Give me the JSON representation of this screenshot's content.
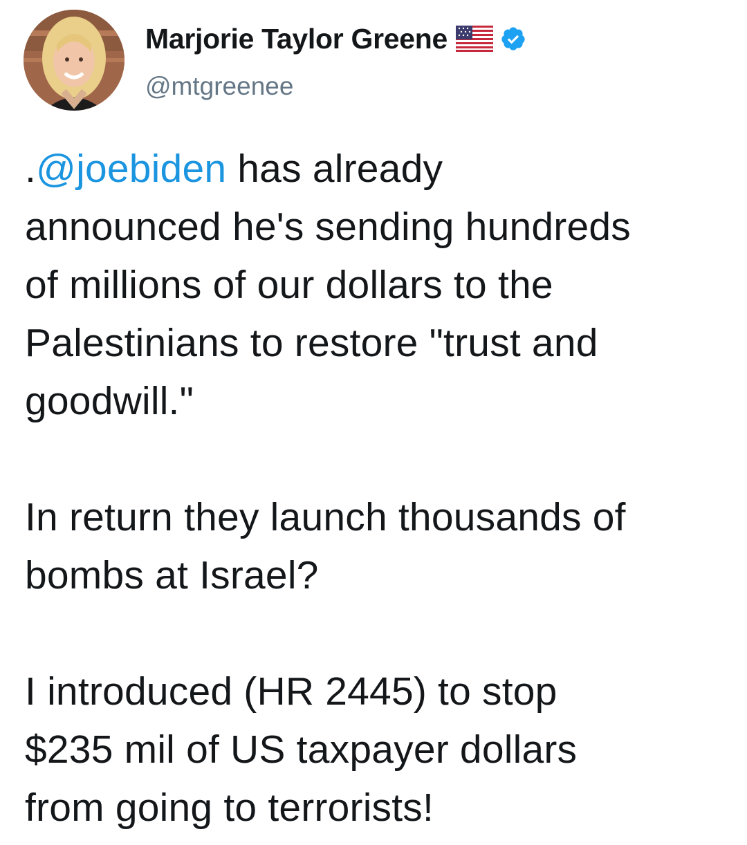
{
  "author": {
    "display_name": "Marjorie Taylor Greene",
    "handle": "@mtgreenee",
    "flag_icon": "us-flag-icon",
    "verified_icon": "verified-badge-icon",
    "verified_color": "#1da1f2"
  },
  "tweet": {
    "mention_prefix": ".",
    "mention": "@joebiden",
    "paragraph_1_line_1_rest": " has already",
    "paragraph_1_line_2": "announced he's sending hundreds",
    "paragraph_1_line_3": "of millions of our dollars to the",
    "paragraph_1_line_4": "Palestinians to restore \"trust and",
    "paragraph_1_line_5": "goodwill.\"",
    "paragraph_2_line_1": "In return they launch thousands of",
    "paragraph_2_line_2": "bombs at Israel?",
    "paragraph_3_line_1": "I introduced (HR 2445) to stop",
    "paragraph_3_line_2": "$235 mil of US taxpayer dollars",
    "paragraph_3_line_3": "from going to terrorists!"
  },
  "colors": {
    "text": "#14171a",
    "secondary": "#657786",
    "link": "#1b95e0"
  }
}
